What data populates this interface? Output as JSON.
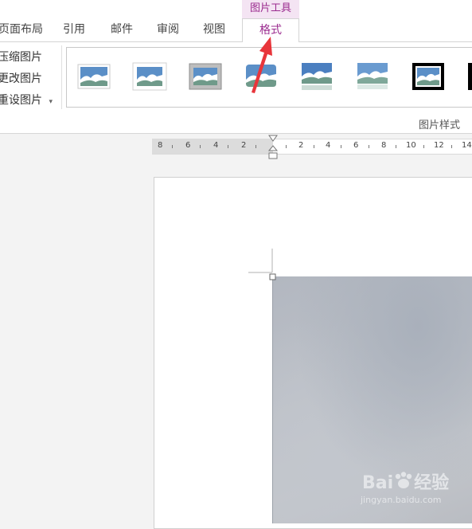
{
  "tabs": {
    "page_layout": "页面布局",
    "references": "引用",
    "mailings": "邮件",
    "review": "审阅",
    "view": "视图",
    "context_group": "图片工具",
    "format": "格式"
  },
  "ribbon": {
    "compress": "压缩图片",
    "change": "更改图片",
    "reset": "重设图片",
    "reset_arrow": "▾",
    "group_label": "图片样式",
    "styles": [
      {
        "name": "simple-frame-white",
        "frame": "#ffffff",
        "border": "#c8c8c8"
      },
      {
        "name": "soft-edge",
        "frame": "#ffffff",
        "border": "#cfcfcf"
      },
      {
        "name": "drop-shadow-gray",
        "frame": "#c6c6c6",
        "border": "#a0a0a0"
      },
      {
        "name": "rounded",
        "frame": "#ffffff",
        "border": "#ffffff"
      },
      {
        "name": "reflected",
        "frame": "#ffffff",
        "border": "#ffffff"
      },
      {
        "name": "soft-reflected",
        "frame": "#ffffff",
        "border": "#ffffff"
      },
      {
        "name": "thick-black-frame",
        "frame": "#000000",
        "border": "#000000"
      }
    ]
  },
  "ruler": {
    "labels": [
      "8",
      "6",
      "4",
      "2",
      "2",
      "4",
      "6",
      "8",
      "10",
      "12",
      "14"
    ]
  },
  "watermark": {
    "brand_a": "Bai",
    "brand_b": "经验",
    "site": "jingyan.baidu.com"
  },
  "colors": {
    "accent": "#9b2c8f",
    "arrow": "#e8353b"
  }
}
